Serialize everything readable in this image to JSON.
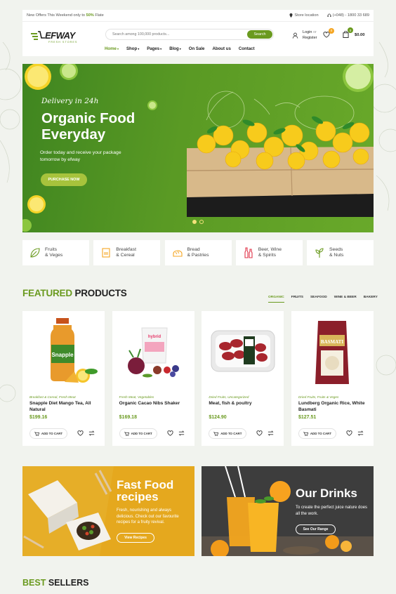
{
  "topbar": {
    "offer_prefix": "New Offers This Weekend only to ",
    "offer_highlight": "50% ",
    "offer_suffix": "Flate",
    "store_location": "Store location",
    "phone": "(+048) - 1800 33 689"
  },
  "header": {
    "logo_text": "EFWAY",
    "logo_sub": "FRESH STORES",
    "search_placeholder": "Search among 100,000 products...",
    "search_button": "Search",
    "login": "Login",
    "or": "or",
    "register": "Register",
    "wishlist_count": "0",
    "cart_count": "0",
    "cart_total": "$0.00"
  },
  "nav": [
    "Home",
    "Shop",
    "Pages",
    "Blog",
    "On Sale",
    "About us",
    "Contact"
  ],
  "hero": {
    "kicker": "Delivery in 24h",
    "title": "Organic Food Everyday",
    "text": "Order today and receive your package tomorrow by efway",
    "button": "PURCHASE NOW"
  },
  "categories": [
    {
      "l1": "Fruits",
      "l2": "& Veges",
      "icon": "leaf-icon"
    },
    {
      "l1": "Breakfast",
      "l2": "& Cereal",
      "icon": "cereal-box-icon"
    },
    {
      "l1": "Bread",
      "l2": "& Pastries",
      "icon": "bread-icon"
    },
    {
      "l1": "Beer, Wine",
      "l2": "& Spirits",
      "icon": "bottles-icon"
    },
    {
      "l1": "Seeds",
      "l2": "& Nuts",
      "icon": "sprout-icon"
    }
  ],
  "featured": {
    "title_hl": "FEATURED",
    "title_rest": " PRODUCTS",
    "tabs": [
      "ORGANIC",
      "FRUITS",
      "SEAFOOD",
      "WINE & BEER",
      "BAKERY"
    ]
  },
  "products": [
    {
      "cat": "Breakfast & Cereal, Fresh Meat",
      "name": "Snapple Diet Mango Tea, All Natural",
      "price": "$199.16"
    },
    {
      "cat": "Fresh Meat, Vegetables",
      "name": "Organic Cacao Nibs Shaker",
      "price": "$169.18"
    },
    {
      "cat": "Dried Fruits, Uncategorized",
      "name": "Meat, fish & poultry",
      "price": "$124.90"
    },
    {
      "cat": "Dried Fruits, Fruits & Veges",
      "name": "Lundberg Organic Rice, White Basmati",
      "price": "$127.51"
    }
  ],
  "add_to_cart": "ADD TO CART",
  "product_labels": {
    "snapple": "Snapple",
    "brand2": "hybrid",
    "basmati": "BASMATI"
  },
  "promos": [
    {
      "title": "Fast Food recipes",
      "text": "Fresh, nourishing and always delicious. Check out our favourite recipes for a fruity revival.",
      "button": "View Recipes"
    },
    {
      "title": "Our Drinks",
      "text": "To create the perfect juice nature does all the work.",
      "button": "See Our Range"
    }
  ],
  "best_sellers": {
    "hl": "BEST",
    "rest": " SELLERS"
  },
  "colors": {
    "brand": "#6a9a1f",
    "accent": "#f5a623",
    "hero": "#4e9022"
  }
}
